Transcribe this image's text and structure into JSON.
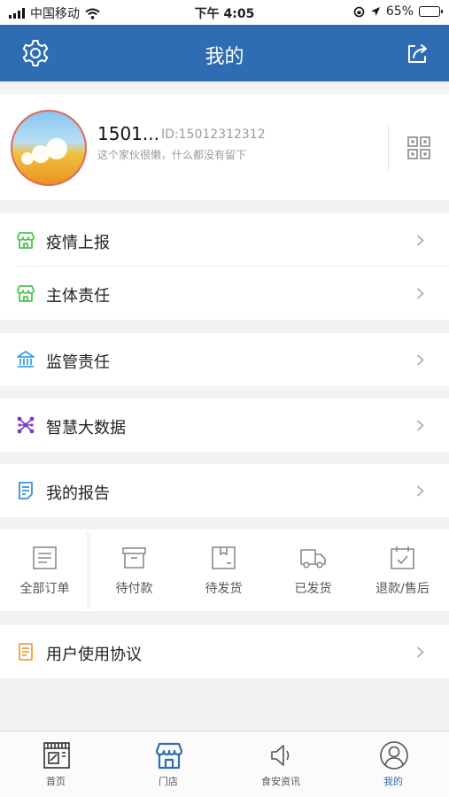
{
  "status_bar": {
    "carrier": "中国移动",
    "time": "下午 4:05",
    "battery": "65%",
    "battery_level": 0.65
  },
  "nav": {
    "title": "我的",
    "left_icon": "gear-icon",
    "right_icon": "share-icon",
    "bar_color": "#2e6db3"
  },
  "profile": {
    "name": "1501...",
    "id_text": "ID:15012312312",
    "signature": "这个家伙很懒，什么都没有留下",
    "qr_icon": "qr-code-icon"
  },
  "menu": {
    "items": [
      {
        "label": "疫情上报",
        "icon": "shop-icon",
        "icon_color": "#4cc552"
      },
      {
        "label": "主体责任",
        "icon": "shop-icon",
        "icon_color": "#4cc552"
      },
      {
        "label": "监管责任",
        "icon": "government-building-icon",
        "icon_color": "#3a9ee8"
      },
      {
        "label": "智慧大数据",
        "icon": "network-nodes-icon",
        "icon_color": "#7d3cc8"
      },
      {
        "label": "我的报告",
        "icon": "report-document-icon",
        "icon_color": "#3a8fe0"
      },
      {
        "label": "用户使用协议",
        "icon": "agreement-document-icon",
        "icon_color": "#f0a040"
      }
    ]
  },
  "orders": {
    "items": [
      {
        "label": "全部订单",
        "icon": "order-list-icon"
      },
      {
        "label": "待付款",
        "icon": "payment-box-icon"
      },
      {
        "label": "待发货",
        "icon": "package-icon"
      },
      {
        "label": "已发货",
        "icon": "truck-icon"
      },
      {
        "label": "退款/售后",
        "icon": "calendar-check-icon"
      }
    ]
  },
  "tabbar": {
    "items": [
      {
        "label": "首页",
        "icon": "storefront-home-icon",
        "active": false
      },
      {
        "label": "门店",
        "icon": "shop-awning-icon",
        "active": false
      },
      {
        "label": "食安资讯",
        "icon": "speaker-icon",
        "active": false
      },
      {
        "label": "我的",
        "icon": "user-profile-icon",
        "active": true
      }
    ],
    "active_color": "#2e6db3"
  }
}
